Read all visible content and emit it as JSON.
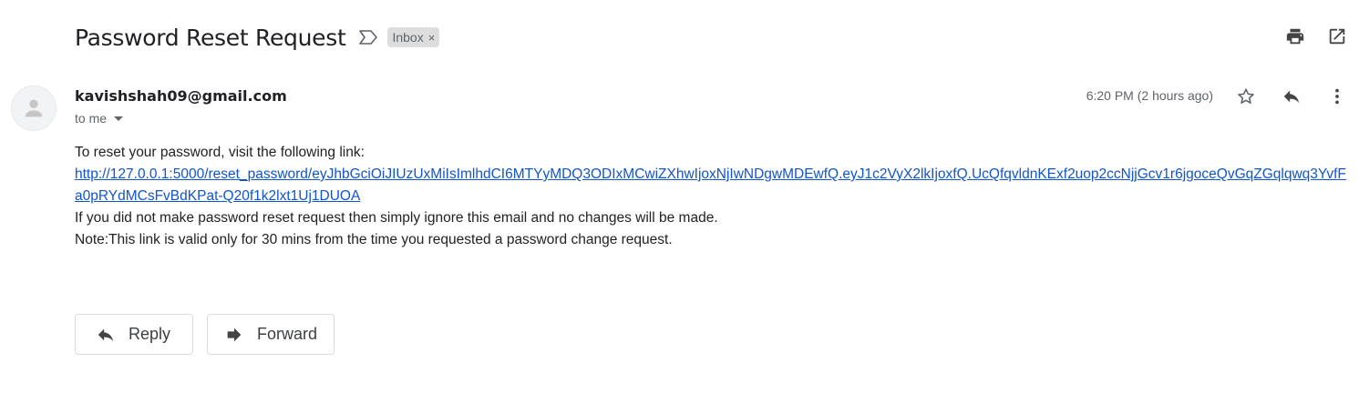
{
  "email": {
    "subject": "Password Reset Request",
    "label": "Inbox",
    "label_remove": "×",
    "sender": "kavishshah09@gmail.com",
    "recipient": "to me",
    "timestamp": "6:20 PM (2 hours ago)",
    "body": {
      "line1": "To reset your password, visit the following link:",
      "link": "http://127.0.0.1:5000/reset_password/eyJhbGciOiJIUzUxMiIsImlhdCI6MTYyMDQ3ODIxMCwiZXhwIjoxNjIwNDgwMDEwfQ.eyJ1c2VyX2lkIjoxfQ.UcQfqvldnKExf2uop2ccNjjGcv1r6jgoceQvGqZGqlqwq3YvfFa0pRYdMCsFvBdKPat-Q20f1k2lxt1Uj1DUOA",
      "line3": "If you did not make password reset request then simply ignore this email and no changes will be made.",
      "line4": "Note:This link is valid only for 30 mins from the time you requested a password change request."
    }
  },
  "actions": {
    "reply_label": "Reply",
    "forward_label": "Forward"
  },
  "icons": {
    "importance": "importance-marker-icon",
    "print": "print-icon",
    "open_new_window": "open-in-new-window-icon",
    "star": "star-icon",
    "reply": "reply-icon",
    "more": "more-vert-icon",
    "avatar": "avatar-icon",
    "forward": "forward-icon"
  },
  "colors": {
    "link": "#1155cc",
    "chip_bg": "#dddddd",
    "secondary_text": "#5f6368",
    "icon": "#5f6368"
  }
}
